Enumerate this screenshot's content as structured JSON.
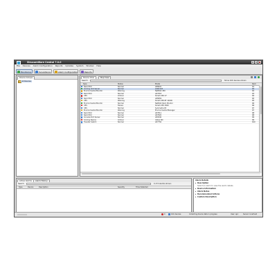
{
  "window": {
    "title": "StruxureWare Central 7.0.0"
  },
  "menu": [
    "File",
    "Devices",
    "Alarm Configuration",
    "Reports",
    "Updates",
    "System",
    "Window",
    "Help"
  ],
  "toolbar": {
    "monitoring": "Monitoring",
    "surveillance": "Surveillance",
    "alarm_configuration": "Alarm Configuration",
    "reports": "Reports"
  },
  "device_groups": {
    "tab": "Device Groups",
    "root": "All Devices"
  },
  "device_view": {
    "tabs": [
      "Device View",
      "Map View"
    ],
    "filter_label": "Search",
    "count_text": "Show 104 devices shown",
    "columns": [
      "Type",
      "Status",
      "Model",
      "Rack"
    ],
    "rows": [
      {
        "type": "Rack PDU",
        "status": "Normal",
        "model": "AP8941",
        "rack": "R1",
        "color": "#3f7fd1"
      },
      {
        "type": "Cooling Unit Server",
        "status": "Normal",
        "model": "ACRC103",
        "rack": "R2",
        "color": "#2e9b3f",
        "selected": true
      },
      {
        "type": "Environmental Monitor",
        "status": "Warning",
        "model": "NetBotz 450",
        "rack": "R2",
        "color": "#d8a21c"
      },
      {
        "type": "Rack PDU",
        "status": "Normal",
        "model": "AP7953",
        "rack": "R3",
        "color": "#3f7fd1"
      },
      {
        "type": "UPS",
        "status": "Critical",
        "model": "Smart-UPS VT",
        "rack": "R4",
        "color": "#cc2a2a"
      },
      {
        "type": "Rack PDU",
        "status": "Normal",
        "model": "AP8959",
        "rack": "R5",
        "color": "#3f7fd1"
      },
      {
        "type": "UPS",
        "status": "Warning",
        "model": "Smart-UPS RT 10000",
        "rack": "R5",
        "color": "#d8a21c"
      },
      {
        "type": "Environmental Monitor",
        "status": "Normal",
        "model": "NetBotz Rack Monitor",
        "rack": "R6",
        "color": "#2e9b3f"
      },
      {
        "type": "UPS",
        "status": "Failure",
        "model": "Smart-UPS 3000",
        "rack": "R6",
        "color": "#cc2a2a"
      },
      {
        "type": "UPS",
        "status": "Normal",
        "model": "Symmetra PX",
        "rack": "R7",
        "color": "#3f7fd1"
      },
      {
        "type": "Environmental Monitor",
        "status": "Warning",
        "model": "Environmental Manager",
        "rack": "R7",
        "color": "#d8a21c"
      },
      {
        "type": "Rack PDU",
        "status": "Normal",
        "model": "AP7811",
        "rack": "R8",
        "color": "#3f7fd1"
      },
      {
        "type": "Rack PDU",
        "status": "Normal",
        "model": "AP7820",
        "rack": "R8",
        "color": "#3f7fd1"
      },
      {
        "type": "Console Port Server",
        "status": "Normal",
        "model": "AP9340",
        "rack": "R9",
        "color": "#3f7fd1"
      },
      {
        "type": "Cooling Device",
        "status": "Critical",
        "model": "InRow RD",
        "rack": "R9",
        "color": "#cc2a2a"
      },
      {
        "type": "Transfer Switch",
        "status": "Normal",
        "model": "AP7750",
        "rack": "R10",
        "color": "#3f7fd1"
      }
    ]
  },
  "alarms": {
    "tabs": [
      "Active Alarms",
      "Alarm History"
    ],
    "filter_label": "Search",
    "count_text": "0 of 0 alarms shown",
    "columns": [
      "Type",
      "Device",
      "Description",
      "Severity",
      "Time Detected"
    ]
  },
  "alarm_details": {
    "title": "Alarm Details",
    "hint": "Select an alarm to view the alarm details.",
    "sections": [
      "Description",
      "Device Information",
      "Alarm Notes",
      "Recommended Actions",
      "Custom Description"
    ]
  },
  "status": {
    "left": "",
    "alarms": "0",
    "devices": "104 devices",
    "message": "Collecting device data in progress",
    "user": "User: apc",
    "server": "Server: localhost"
  },
  "colors": {
    "accent": "#3f7fd1",
    "selection": "#c7d7ee"
  }
}
